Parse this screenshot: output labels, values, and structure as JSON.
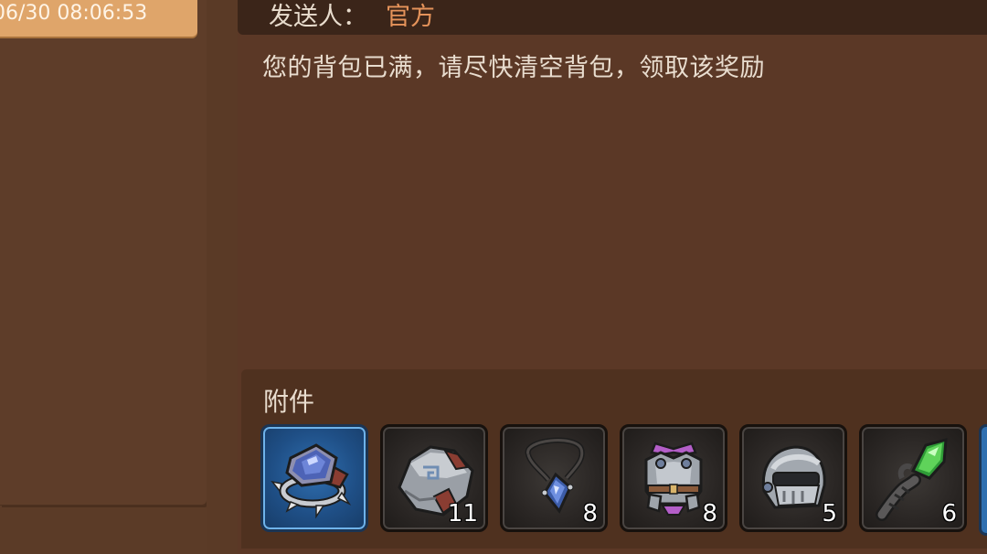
{
  "mail_list": {
    "selected_item": {
      "date": "06/30 08:06:53"
    }
  },
  "mail_detail": {
    "sender_label": "发送人：",
    "sender_name": "官方",
    "body": "您的背包已满，请尽快清空背包，领取该奖励",
    "attachments_title": "附件",
    "attachments": [
      {
        "icon": "sapphire-spiked-ring-icon",
        "count": "",
        "selected": true
      },
      {
        "icon": "stone-ore-icon",
        "count": "11"
      },
      {
        "icon": "sapphire-pendant-icon",
        "count": "8"
      },
      {
        "icon": "chest-armor-icon",
        "count": "8"
      },
      {
        "icon": "knight-helmet-icon",
        "count": "5"
      },
      {
        "icon": "emerald-staff-icon",
        "count": "6"
      }
    ]
  },
  "colors": {
    "background": "#5b3b27",
    "selected_mail": "#dfa56a",
    "sender_name": "#e5935a",
    "selected_slot": "#2f6fb0"
  }
}
